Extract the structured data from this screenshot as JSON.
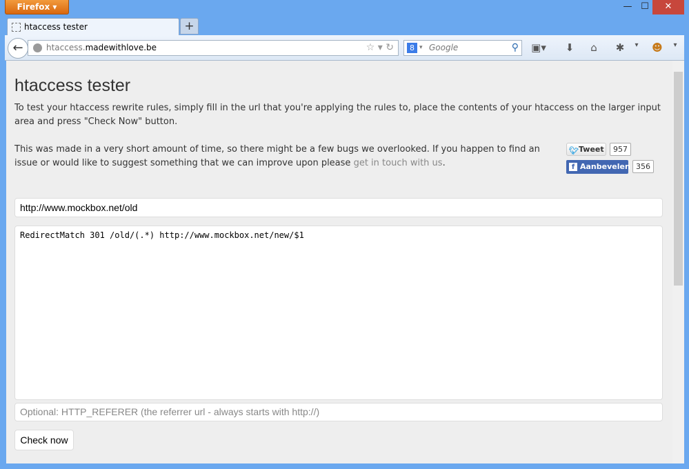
{
  "browser": {
    "menu_button": "Firefox",
    "tab_title": "htaccess tester",
    "new_tab": "+",
    "url_host": "htaccess.",
    "url_domain": "madewithlove.be",
    "search_placeholder": "Google",
    "window_controls": {
      "minimize": "—",
      "maximize": "☐",
      "close": "✕"
    }
  },
  "page": {
    "title": "htaccess tester",
    "intro": "To test your htaccess rewrite rules, simply fill in the url that you're applying the rules to, place the contents of your htaccess on the larger input area and press \"Check Now\" button.",
    "note_before": "This was made in a very short amount of time, so there might be a few bugs we overlooked. If you happen to find an issue or would like to suggest something that we can improve upon please ",
    "note_link": "get in touch with us",
    "note_after": ".",
    "tweet_label": "Tweet",
    "tweet_count": "957",
    "fb_label": "Aanbevelen",
    "fb_count": "356",
    "url_value": "http://www.mockbox.net/old",
    "rules_value": "RedirectMatch 301 /old/(.*) http://www.mockbox.net/new/$1",
    "referer_placeholder": "Optional: HTTP_REFERER (the referrer url - always starts with http://)",
    "check_button": "Check now"
  },
  "colors": {
    "frame": "#6aa8ef",
    "firefox_button": "#e07a1f",
    "facebook": "#4267b2",
    "twitter": "#2ba3e3"
  }
}
